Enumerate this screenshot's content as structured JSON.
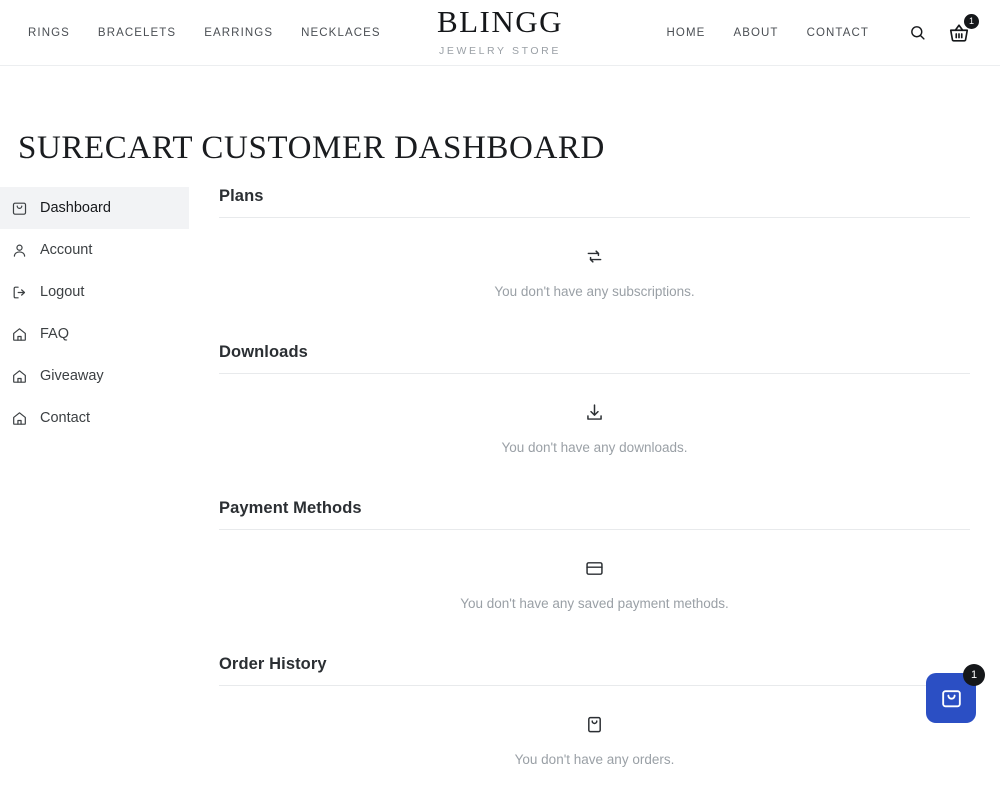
{
  "header": {
    "nav_left": [
      {
        "label": "RINGS"
      },
      {
        "label": "BRACELETS"
      },
      {
        "label": "EARRINGS"
      },
      {
        "label": "NECKLACES"
      }
    ],
    "brand": {
      "name": "BLINGG",
      "subtitle": "JEWELRY STORE"
    },
    "nav_right": [
      {
        "label": "HOME"
      },
      {
        "label": "ABOUT"
      },
      {
        "label": "CONTACT"
      }
    ],
    "search_icon": "search-icon",
    "cart_icon": "shopping-basket-icon",
    "cart_count": "1"
  },
  "page": {
    "title": "SURECART CUSTOMER DASHBOARD"
  },
  "sidebar": {
    "items": [
      {
        "label": "Dashboard",
        "icon": "shopping-bag-icon",
        "active": true
      },
      {
        "label": "Account",
        "icon": "user-icon",
        "active": false
      },
      {
        "label": "Logout",
        "icon": "log-out-icon",
        "active": false
      },
      {
        "label": "FAQ",
        "icon": "home-icon",
        "active": false
      },
      {
        "label": "Giveaway",
        "icon": "home-icon",
        "active": false
      },
      {
        "label": "Contact",
        "icon": "home-icon",
        "active": false
      }
    ]
  },
  "main": {
    "sections": [
      {
        "title": "Plans",
        "icon": "repeat-icon",
        "empty_text": "You don't have any subscriptions."
      },
      {
        "title": "Downloads",
        "icon": "download-icon",
        "empty_text": "You don't have any downloads."
      },
      {
        "title": "Payment Methods",
        "icon": "credit-card-icon",
        "empty_text": "You don't have any saved payment methods."
      },
      {
        "title": "Order History",
        "icon": "shopping-bag-icon",
        "empty_text": "You don't have any orders."
      }
    ]
  },
  "floating_cart": {
    "icon": "shopping-bag-icon",
    "count": "1",
    "color": "#2b4fc4"
  }
}
